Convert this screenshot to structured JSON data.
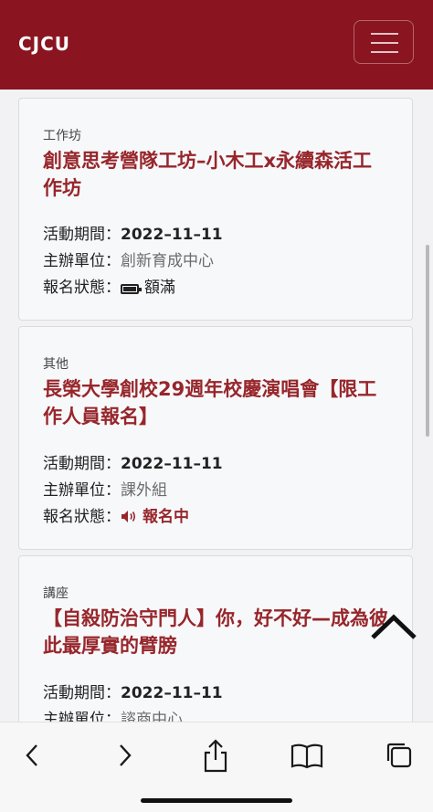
{
  "header": {
    "logo_text": "CJCU",
    "brand_color": "#8a1420"
  },
  "labels": {
    "period": "活動期間：",
    "organizer": "主辦單位：",
    "status": "報名狀態："
  },
  "cards": [
    {
      "category": "工作坊",
      "title": "創意思考營隊工坊–小木工x永續森活工作坊",
      "period": "2022–11–11",
      "organizer": "創新育成中心",
      "status": "額滿",
      "status_icon": "battery-full-icon"
    },
    {
      "category": "其他",
      "title": "長榮大學創校29週年校慶演唱會【限工作人員報名】",
      "period": "2022–11–11",
      "organizer": "課外組",
      "status": "報名中",
      "status_icon": "speaker-icon"
    },
    {
      "category": "講座",
      "title": "【自殺防治守門人】你，好不好—成為彼此最厚實的臂膀",
      "period": "2022–11–11",
      "organizer": "諮商中心"
    }
  ],
  "colors": {
    "accent": "#97262b",
    "page_bg": "#f2f2f4",
    "card_bg": "#f7f8fa"
  }
}
